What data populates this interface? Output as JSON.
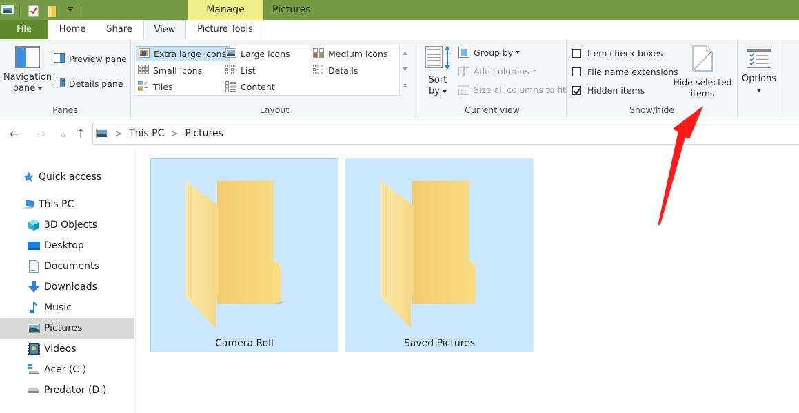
{
  "window": {
    "title": "Pictures",
    "contextual_tab_group": "Manage",
    "titlebar_color": "#769b46",
    "quick_access_toolbar": [
      "window-icon",
      "properties-icon",
      "new-folder-icon",
      "customize-dropdown-icon"
    ]
  },
  "tabs": [
    {
      "label": "File",
      "active": false
    },
    {
      "label": "Home",
      "active": false
    },
    {
      "label": "Share",
      "active": false
    },
    {
      "label": "View",
      "active": true
    },
    {
      "label": "Picture Tools",
      "active": false
    }
  ],
  "ribbon": {
    "panes": {
      "label": "Panes",
      "navigation_pane": "Navigation pane",
      "navigation_pane_line1": "Navigation",
      "navigation_pane_line2": "pane",
      "preview_pane": "Preview pane",
      "details_pane": "Details pane"
    },
    "layout": {
      "label": "Layout",
      "items": [
        {
          "label": "Extra large icons",
          "selected": true
        },
        {
          "label": "Large icons",
          "selected": false
        },
        {
          "label": "Medium icons",
          "selected": false
        },
        {
          "label": "Small icons",
          "selected": false
        },
        {
          "label": "List",
          "selected": false
        },
        {
          "label": "Details",
          "selected": false
        },
        {
          "label": "Tiles",
          "selected": false
        },
        {
          "label": "Content",
          "selected": false
        }
      ]
    },
    "current_view": {
      "label": "Current view",
      "sort_by_line1": "Sort",
      "sort_by_line2": "by",
      "group_by": "Group by",
      "add_columns": "Add columns",
      "size_columns": "Size all columns to fit"
    },
    "show_hide": {
      "label": "Show/hide",
      "item_check_boxes": {
        "label": "Item check boxes",
        "checked": false
      },
      "file_name_extensions": {
        "label": "File name extensions",
        "checked": false
      },
      "hidden_items": {
        "label": "Hidden items",
        "checked": true
      },
      "hide_selected_line1": "Hide selected",
      "hide_selected_line2": "items"
    },
    "options": {
      "label": "Options"
    }
  },
  "address": {
    "breadcrumb": [
      "This PC",
      "Pictures"
    ]
  },
  "sidebar": {
    "items": [
      {
        "label": "Quick access",
        "icon": "star-icon",
        "selected": false
      },
      {
        "label": "This PC",
        "icon": "computer-icon",
        "selected": false
      },
      {
        "label": "3D Objects",
        "icon": "cube-icon",
        "selected": false
      },
      {
        "label": "Desktop",
        "icon": "desktop-icon",
        "selected": false
      },
      {
        "label": "Documents",
        "icon": "document-icon",
        "selected": false
      },
      {
        "label": "Downloads",
        "icon": "download-icon",
        "selected": false
      },
      {
        "label": "Music",
        "icon": "music-icon",
        "selected": false
      },
      {
        "label": "Pictures",
        "icon": "pictures-icon",
        "selected": true
      },
      {
        "label": "Videos",
        "icon": "videos-icon",
        "selected": false
      },
      {
        "label": "Acer (C:)",
        "icon": "windows-drive-icon",
        "selected": false
      },
      {
        "label": "Predator (D:)",
        "icon": "drive-icon",
        "selected": false
      }
    ]
  },
  "folders": [
    {
      "name": "Camera Roll",
      "selected": true
    },
    {
      "name": "Saved Pictures",
      "selected": true
    }
  ],
  "annotation": {
    "type": "red-arrow",
    "points_to": "Hide selected items",
    "color": "#ff1a1a"
  }
}
